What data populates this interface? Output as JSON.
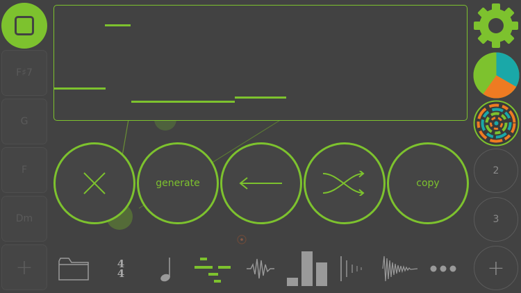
{
  "chords": [
    {
      "label": "F♯7"
    },
    {
      "label": "G"
    },
    {
      "label": "F"
    },
    {
      "label": "Dm"
    }
  ],
  "chord_add_label": "+",
  "actions": {
    "clear_icon": "x-icon",
    "generate_label": "generate",
    "back_icon": "arrow-left-icon",
    "shuffle_icon": "shuffle-icon",
    "copy_label": "copy"
  },
  "side": {
    "settings_icon": "gear-icon",
    "pattern2_label": "2",
    "pattern3_label": "3",
    "add_label": "+"
  },
  "toolbar": {
    "time_signature_top": "4",
    "time_signature_bottom": "4"
  },
  "colors": {
    "accent": "#7dc22e",
    "teal": "#1aa8a8",
    "orange": "#ee7b22",
    "background": "#424242"
  }
}
